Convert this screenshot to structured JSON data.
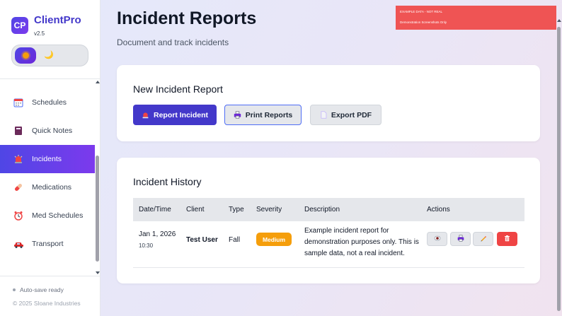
{
  "app": {
    "logo": "CP",
    "name": "ClientPro",
    "version": "v2.5"
  },
  "theme": {
    "light_icon": "sun-icon",
    "dark_icon": "moon-icon",
    "dark_glyph": "🌙"
  },
  "sidebar": {
    "items": [
      {
        "label": "Schedules",
        "icon": "calendar-icon",
        "active": false
      },
      {
        "label": "Quick Notes",
        "icon": "notebook-icon",
        "active": false
      },
      {
        "label": "Incidents",
        "icon": "siren-icon",
        "active": true
      },
      {
        "label": "Medications",
        "icon": "pill-icon",
        "active": false
      },
      {
        "label": "Med Schedules",
        "icon": "alarm-clock-icon",
        "active": false
      },
      {
        "label": "Transport",
        "icon": "car-icon",
        "active": false
      }
    ],
    "autosave": "Auto-save ready",
    "copyright": "© 2025 Sloane Industries"
  },
  "header": {
    "title": "Incident Reports",
    "subtitle": "Document and track incidents"
  },
  "watermark": {
    "line1": "EXAMPLE DATA - NOT REAL",
    "line2": "Demonstration Screenshots Only"
  },
  "new_report": {
    "title": "New Incident Report",
    "report_label": "Report Incident",
    "print_label": "Print Reports",
    "pdf_label": "Export PDF"
  },
  "history": {
    "title": "Incident History",
    "columns": [
      "Date/Time",
      "Client",
      "Type",
      "Severity",
      "Description",
      "Actions"
    ],
    "rows": [
      {
        "date": "Jan 1, 2026",
        "time": "10:30",
        "client": "Test User",
        "type": "Fall",
        "severity": "Medium",
        "description": "Example incident report for demonstration purposes only. This is sample data, not a real incident."
      }
    ]
  },
  "colors": {
    "accent": "#4338ca",
    "accent_gradient_end": "#7c3aed",
    "severity_medium": "#f59e0b",
    "danger": "#ef4444",
    "watermark": "#ef5454"
  }
}
